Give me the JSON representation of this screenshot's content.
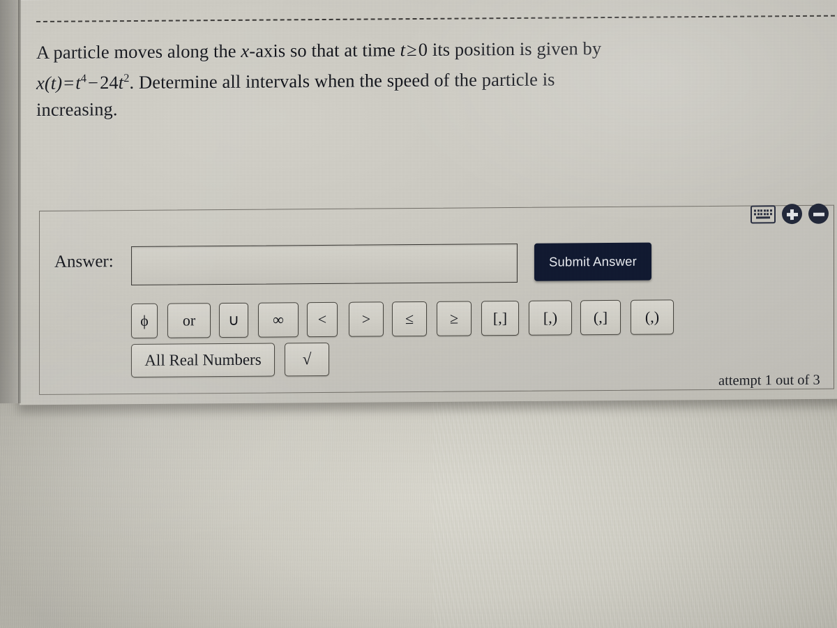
{
  "question": {
    "line1_pre": "A particle moves along the ",
    "line1_var": "x",
    "line1_mid": "-axis so that at time ",
    "line1_t": "t",
    "line1_rel": "≥",
    "line1_zero": "0",
    "line1_post": " its position is given by",
    "line2_fn": "x",
    "line2_arg": "(t)",
    "line2_eq": "=",
    "line2_t1": "t",
    "line2_exp1": "4",
    "line2_minus": "−",
    "line2_coef": "24",
    "line2_t2": "t",
    "line2_exp2": "2",
    "line2_post": ". Determine all intervals when the speed of the particle is",
    "line3": "increasing.",
    "full_text": "A particle moves along the x-axis so that at time t ≥ 0 its position is given by x(t) = t^4 − 24t^2. Determine all intervals when the speed of the particle is increasing."
  },
  "answer": {
    "label": "Answer:",
    "value": "",
    "placeholder": ""
  },
  "submit": {
    "label": "Submit Answer",
    "color": "#121b33",
    "text_color": "#f0f2f7"
  },
  "palette": {
    "row1": [
      {
        "label": "ϕ",
        "name": "empty-set-button"
      },
      {
        "label": "or",
        "name": "or-button"
      },
      {
        "label": "∪",
        "name": "union-button"
      },
      {
        "label": "∞",
        "name": "infinity-button"
      },
      {
        "label": "<",
        "name": "less-than-button"
      },
      {
        "label": ">",
        "name": "greater-than-button"
      },
      {
        "label": "≤",
        "name": "less-than-or-equal-button"
      },
      {
        "label": "≥",
        "name": "greater-than-or-equal-button"
      },
      {
        "label": "[,]",
        "name": "closed-interval-button"
      },
      {
        "label": "[,)",
        "name": "half-open-right-interval-button"
      },
      {
        "label": "(,]",
        "name": "half-open-left-interval-button"
      },
      {
        "label": "(,)",
        "name": "open-interval-button"
      }
    ],
    "row2": [
      {
        "label": "All Real Numbers",
        "name": "all-real-numbers-button"
      },
      {
        "label": "√",
        "name": "radical-button"
      }
    ]
  },
  "icons": {
    "keyboard": "keyboard-icon",
    "zoom_in": "plus-circle-icon",
    "zoom_out": "minus-circle-icon"
  },
  "status": {
    "attempt": "attempt 1 out of 3"
  }
}
